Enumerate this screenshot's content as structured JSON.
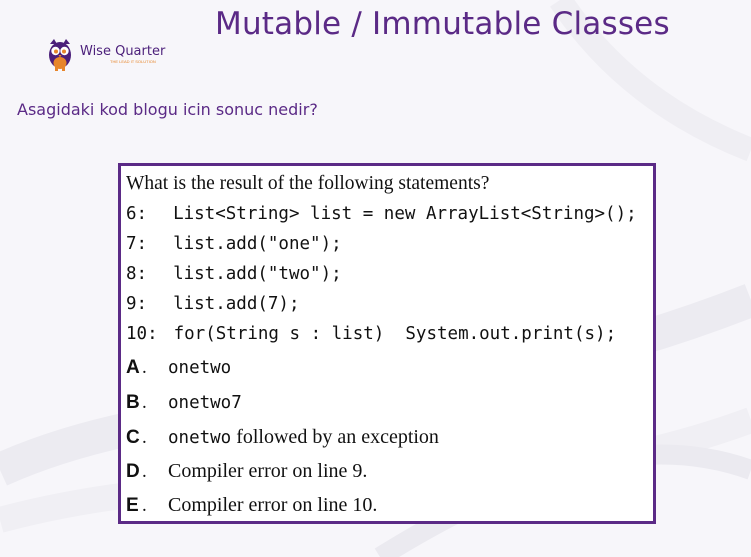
{
  "slide": {
    "title": "Mutable / Immutable Classes",
    "subtitle": "Asagidaki kod blogu icin sonuc nedir?"
  },
  "logo": {
    "name": "Wise Quarter",
    "tagline": "THE LEAD IT SOLUTION",
    "icon": "owl-icon",
    "colors": {
      "purple": "#4b1f7a",
      "orange": "#e7852a"
    }
  },
  "question": {
    "header": "What is the result of the following statements?",
    "code": [
      {
        "num": "6:",
        "code": "List<String> list = new ArrayList<String>();"
      },
      {
        "num": "7:",
        "code": "list.add(\"one\");"
      },
      {
        "num": "8:",
        "code": "list.add(\"two\");"
      },
      {
        "num": "9:",
        "code": "list.add(7);"
      },
      {
        "num": "10:",
        "code": "for(String s : list)  System.out.print(s);"
      }
    ],
    "options": [
      {
        "letter": "A",
        "mono": "onetwo",
        "text": ""
      },
      {
        "letter": "B",
        "mono": "onetwo7",
        "text": ""
      },
      {
        "letter": "C",
        "mono": "onetwo",
        "text": " followed by an exception"
      },
      {
        "letter": "D",
        "mono": "",
        "text": "Compiler error on line 9."
      },
      {
        "letter": "E",
        "mono": "",
        "text": "Compiler error on line 10."
      }
    ]
  },
  "colors": {
    "accent": "#5b2a86",
    "box_border": "#5b2a86"
  }
}
